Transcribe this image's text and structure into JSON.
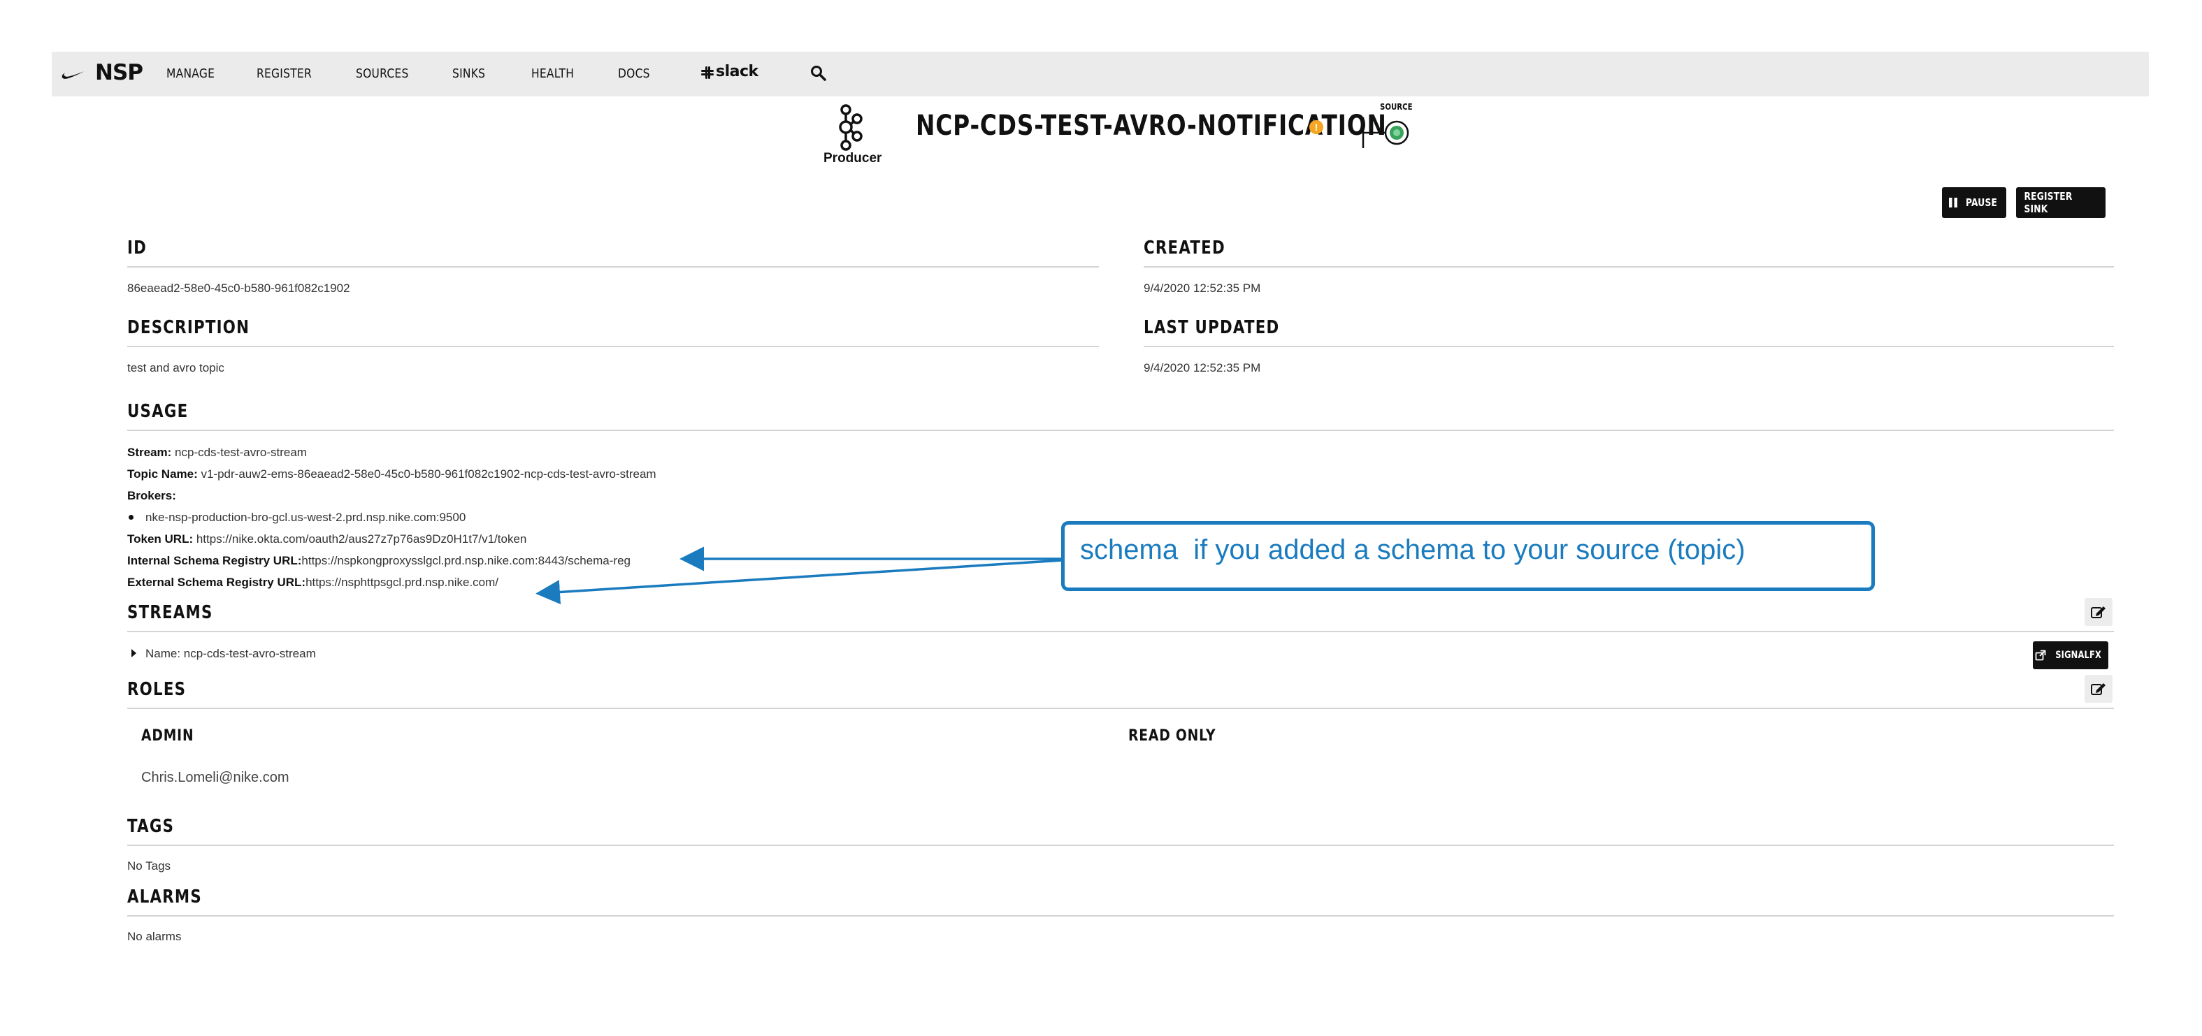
{
  "nav": {
    "brand": "NSP",
    "items": [
      "MANAGE",
      "REGISTER",
      "SOURCES",
      "SINKS",
      "HEALTH",
      "DOCS"
    ],
    "slack": "slack"
  },
  "header": {
    "producer_label": "Producer",
    "title": "NCP-CDS-TEST-AVRO-NOTIFICATION",
    "warning_glyph": "!",
    "source_label": "SOURCE"
  },
  "actions": {
    "pause": "PAUSE",
    "register_sink": "REGISTER SINK",
    "signalfx": "SIGNALFX"
  },
  "details": {
    "id_label": "ID",
    "id_value": "86eaead2-58e0-45c0-b580-961f082c1902",
    "created_label": "CREATED",
    "created_value": "9/4/2020 12:52:35 PM",
    "description_label": "DESCRIPTION",
    "description_value": "test and avro topic",
    "updated_label": "LAST UPDATED",
    "updated_value": "9/4/2020 12:52:35 PM"
  },
  "usage": {
    "heading": "USAGE",
    "stream_label": "Stream:",
    "stream_value": " ncp-cds-test-avro-stream",
    "topic_label": "Topic Name:",
    "topic_value": " v1-pdr-auw2-ems-86eaead2-58e0-45c0-b580-961f082c1902-ncp-cds-test-avro-stream",
    "brokers_label": "Brokers:",
    "broker_1": "nke-nsp-production-bro-gcl.us-west-2.prd.nsp.nike.com:9500",
    "token_label": "Token URL:",
    "token_value": " https://nike.okta.com/oauth2/aus27z7p76as9Dz0H1t7/v1/token",
    "internal_schema_label": "Internal Schema Registry URL:",
    "internal_schema_value": "https://nspkongproxysslgcl.prd.nsp.nike.com:8443/schema-reg",
    "external_schema_label": "External Schema Registry URL:",
    "external_schema_value": "https://nsphttpsgcl.prd.nsp.nike.com/"
  },
  "streams": {
    "heading": "STREAMS",
    "item": "Name: ncp-cds-test-avro-stream"
  },
  "roles": {
    "heading": "ROLES",
    "admin_label": "ADMIN",
    "readonly_label": "READ ONLY",
    "admin_user": "Chris.Lomeli@nike.com"
  },
  "tags": {
    "heading": "TAGS",
    "value": "No Tags"
  },
  "alarms": {
    "heading": "ALARMS",
    "value": "No alarms"
  },
  "annotation": {
    "text": "schema  if you added a schema to your source (topic)"
  },
  "colors": {
    "annotation": "#1a7bbf",
    "warning": "#f5a623",
    "source_green": "#3aa35b"
  }
}
